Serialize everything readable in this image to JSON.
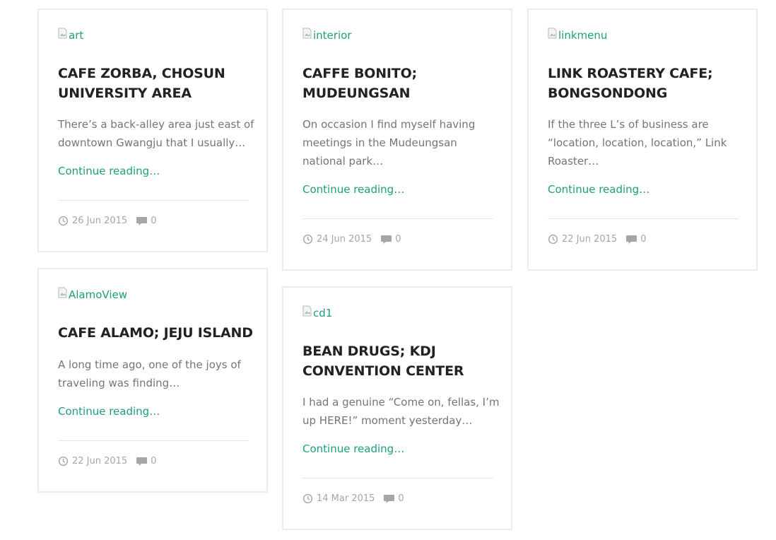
{
  "posts": [
    {
      "image_alt": "art",
      "title": "CAFE ZORBA, CHOSUN UNIVERSITY AREA",
      "excerpt": "There’s a back-alley area just east of downtown Gwangju that I usually…",
      "more": "Continue reading…",
      "date": "26 Jun 2015",
      "comments": "0"
    },
    {
      "image_alt": "interior",
      "title": "CAFFE BONITO; MUDEUNGSAN",
      "excerpt": "On occasion I find myself having meetings in the Mudeungsan national park…",
      "more": "Continue reading…",
      "date": "24 Jun 2015",
      "comments": "0"
    },
    {
      "image_alt": "linkmenu",
      "title": "LINK ROASTERY CAFE; BONGSONDONG",
      "excerpt": "If the three L’s of business are “location, location, location,” Link Roaster…",
      "more": "Continue reading…",
      "date": "22 Jun 2015",
      "comments": "0"
    },
    {
      "image_alt": "AlamoView",
      "title": "CAFE ALAMO; JEJU ISLAND",
      "excerpt": "A long time ago, one of the joys of traveling was finding…",
      "more": "Continue reading…",
      "date": "22 Jun 2015",
      "comments": "0"
    },
    {
      "image_alt": "cd1",
      "title": "BEAN DRUGS; KDJ CONVENTION CENTER",
      "excerpt": "I had a genuine “Come on, fellas, I’m up HERE!” moment yesterday…",
      "more": "Continue reading…",
      "date": "14 Mar 2015",
      "comments": "0"
    }
  ]
}
